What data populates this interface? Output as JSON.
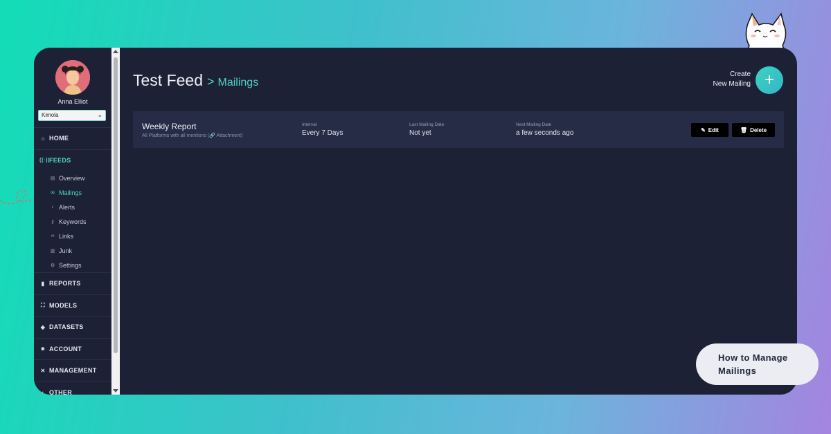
{
  "user": {
    "name": "Anna Elliot",
    "workspace": "Kimola"
  },
  "nav": {
    "sections": [
      {
        "key": "home",
        "label": "HOME",
        "icon": "home-icon"
      },
      {
        "key": "feeds",
        "label": "FEEDS",
        "icon": "broadcast-icon",
        "active": true,
        "items": [
          {
            "label": "Overview",
            "icon": "overview-icon"
          },
          {
            "label": "Mailings",
            "icon": "envelope-icon",
            "active": true
          },
          {
            "label": "Alerts",
            "icon": "bell-icon"
          },
          {
            "label": "Keywords",
            "icon": "key-icon"
          },
          {
            "label": "Links",
            "icon": "link-icon"
          },
          {
            "label": "Junk",
            "icon": "trash-icon"
          },
          {
            "label": "Settings",
            "icon": "gear-icon"
          }
        ]
      },
      {
        "key": "reports",
        "label": "REPORTS",
        "icon": "bar-chart-icon"
      },
      {
        "key": "models",
        "label": "MODELS",
        "icon": "models-icon"
      },
      {
        "key": "datasets",
        "label": "DATASETS",
        "icon": "layers-icon"
      },
      {
        "key": "account",
        "label": "ACCOUNT",
        "icon": "user-gear-icon"
      },
      {
        "key": "management",
        "label": "MANAGEMENT",
        "icon": "tools-icon"
      },
      {
        "key": "other",
        "label": "OTHER",
        "icon": "other-icon"
      }
    ]
  },
  "header": {
    "title": "Test Feed",
    "breadcrumb_separator": ">",
    "breadcrumb": "Mailings",
    "create_label_line1": "Create",
    "create_label_line2": "New Mailing",
    "create_button": "+"
  },
  "mailings": [
    {
      "name": "Weekly Report",
      "description": "All Platforms with all mentions (🔗 Attachment)",
      "interval_label": "Interval",
      "interval": "Every 7 Days",
      "last_label": "Last Mailing Date",
      "last": "Not yet",
      "next_label": "Next Mailing Date",
      "next": "a few seconds ago",
      "edit_label": "Edit",
      "delete_label": "Delete"
    }
  ],
  "overlay": {
    "title_line1": "How to Manage",
    "title_line2": "Mailings"
  },
  "colors": {
    "accent": "#4fd1c1",
    "panel": "#1d2136",
    "row": "#262c46"
  }
}
